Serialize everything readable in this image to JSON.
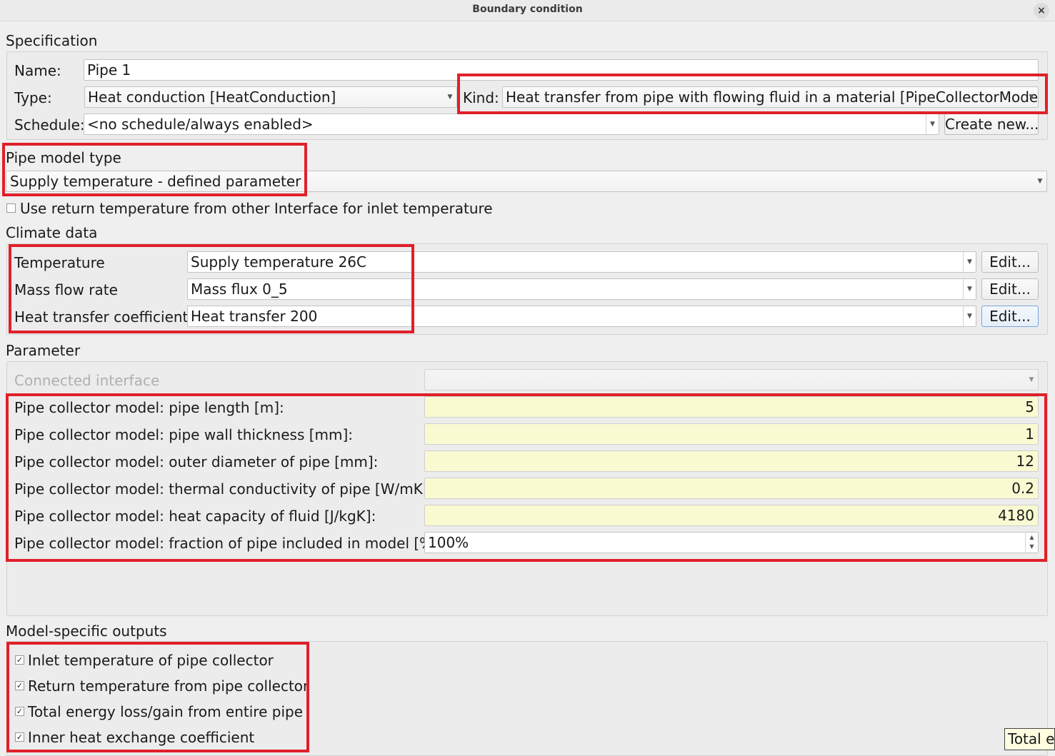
{
  "window": {
    "title": "Boundary condition",
    "close_glyph": "×"
  },
  "specification": {
    "heading": "Specification",
    "name_label": "Name:",
    "name_value": "Pipe 1",
    "type_label": "Type:",
    "type_value": "Heat conduction [HeatConduction]",
    "kind_label": "Kind:",
    "kind_value": "Heat transfer from pipe with flowing fluid in a material [PipeCollectorModel]",
    "schedule_label": "Schedule:",
    "schedule_value": "<no schedule/always enabled>",
    "create_new_label": "Create new..."
  },
  "pipe_model": {
    "heading": "Pipe model type",
    "value": "Supply temperature - defined parameter"
  },
  "return_temp_checkbox": {
    "label": "Use return temperature from other Interface for inlet temperature",
    "checked": false
  },
  "climate": {
    "heading": "Climate data",
    "rows": [
      {
        "label": "Temperature",
        "value": "Supply temperature 26C",
        "edit": "Edit..."
      },
      {
        "label": "Mass flow rate",
        "value": "Mass flux 0_5",
        "edit": "Edit..."
      },
      {
        "label": "Heat transfer coefficient",
        "value": "Heat transfer 200",
        "edit": "Edit..."
      }
    ]
  },
  "parameter": {
    "heading": "Parameter",
    "connected_interface_label": "Connected interface",
    "rows": [
      {
        "label": "Pipe collector model: pipe length [m]:",
        "value": "5"
      },
      {
        "label": "Pipe collector model: pipe wall thickness [mm]:",
        "value": "1"
      },
      {
        "label": "Pipe collector model: outer diameter of pipe [mm]:",
        "value": "12"
      },
      {
        "label": "Pipe collector model: thermal conductivity of pipe [W/mK]:",
        "value": "0.2"
      },
      {
        "label": "Pipe collector model: heat capacity of fluid [J/kgK]:",
        "value": "4180"
      }
    ],
    "fraction_label": "Pipe collector model: fraction of pipe included in model [%]:",
    "fraction_value": "100%"
  },
  "outputs": {
    "heading": "Model-specific outputs",
    "items": [
      {
        "label": "Inlet temperature of pipe collector",
        "checked": true
      },
      {
        "label": "Return temperature from pipe collector",
        "checked": true
      },
      {
        "label": "Total energy loss/gain from entire pipe",
        "checked": true
      },
      {
        "label": "Inner heat exchange coefficient",
        "checked": true
      }
    ],
    "check_glyph": "✓"
  },
  "tooltip": {
    "text": "Total er"
  },
  "colors": {
    "highlight": "#e0202a",
    "numeric_field_bg": "#fafad2"
  }
}
